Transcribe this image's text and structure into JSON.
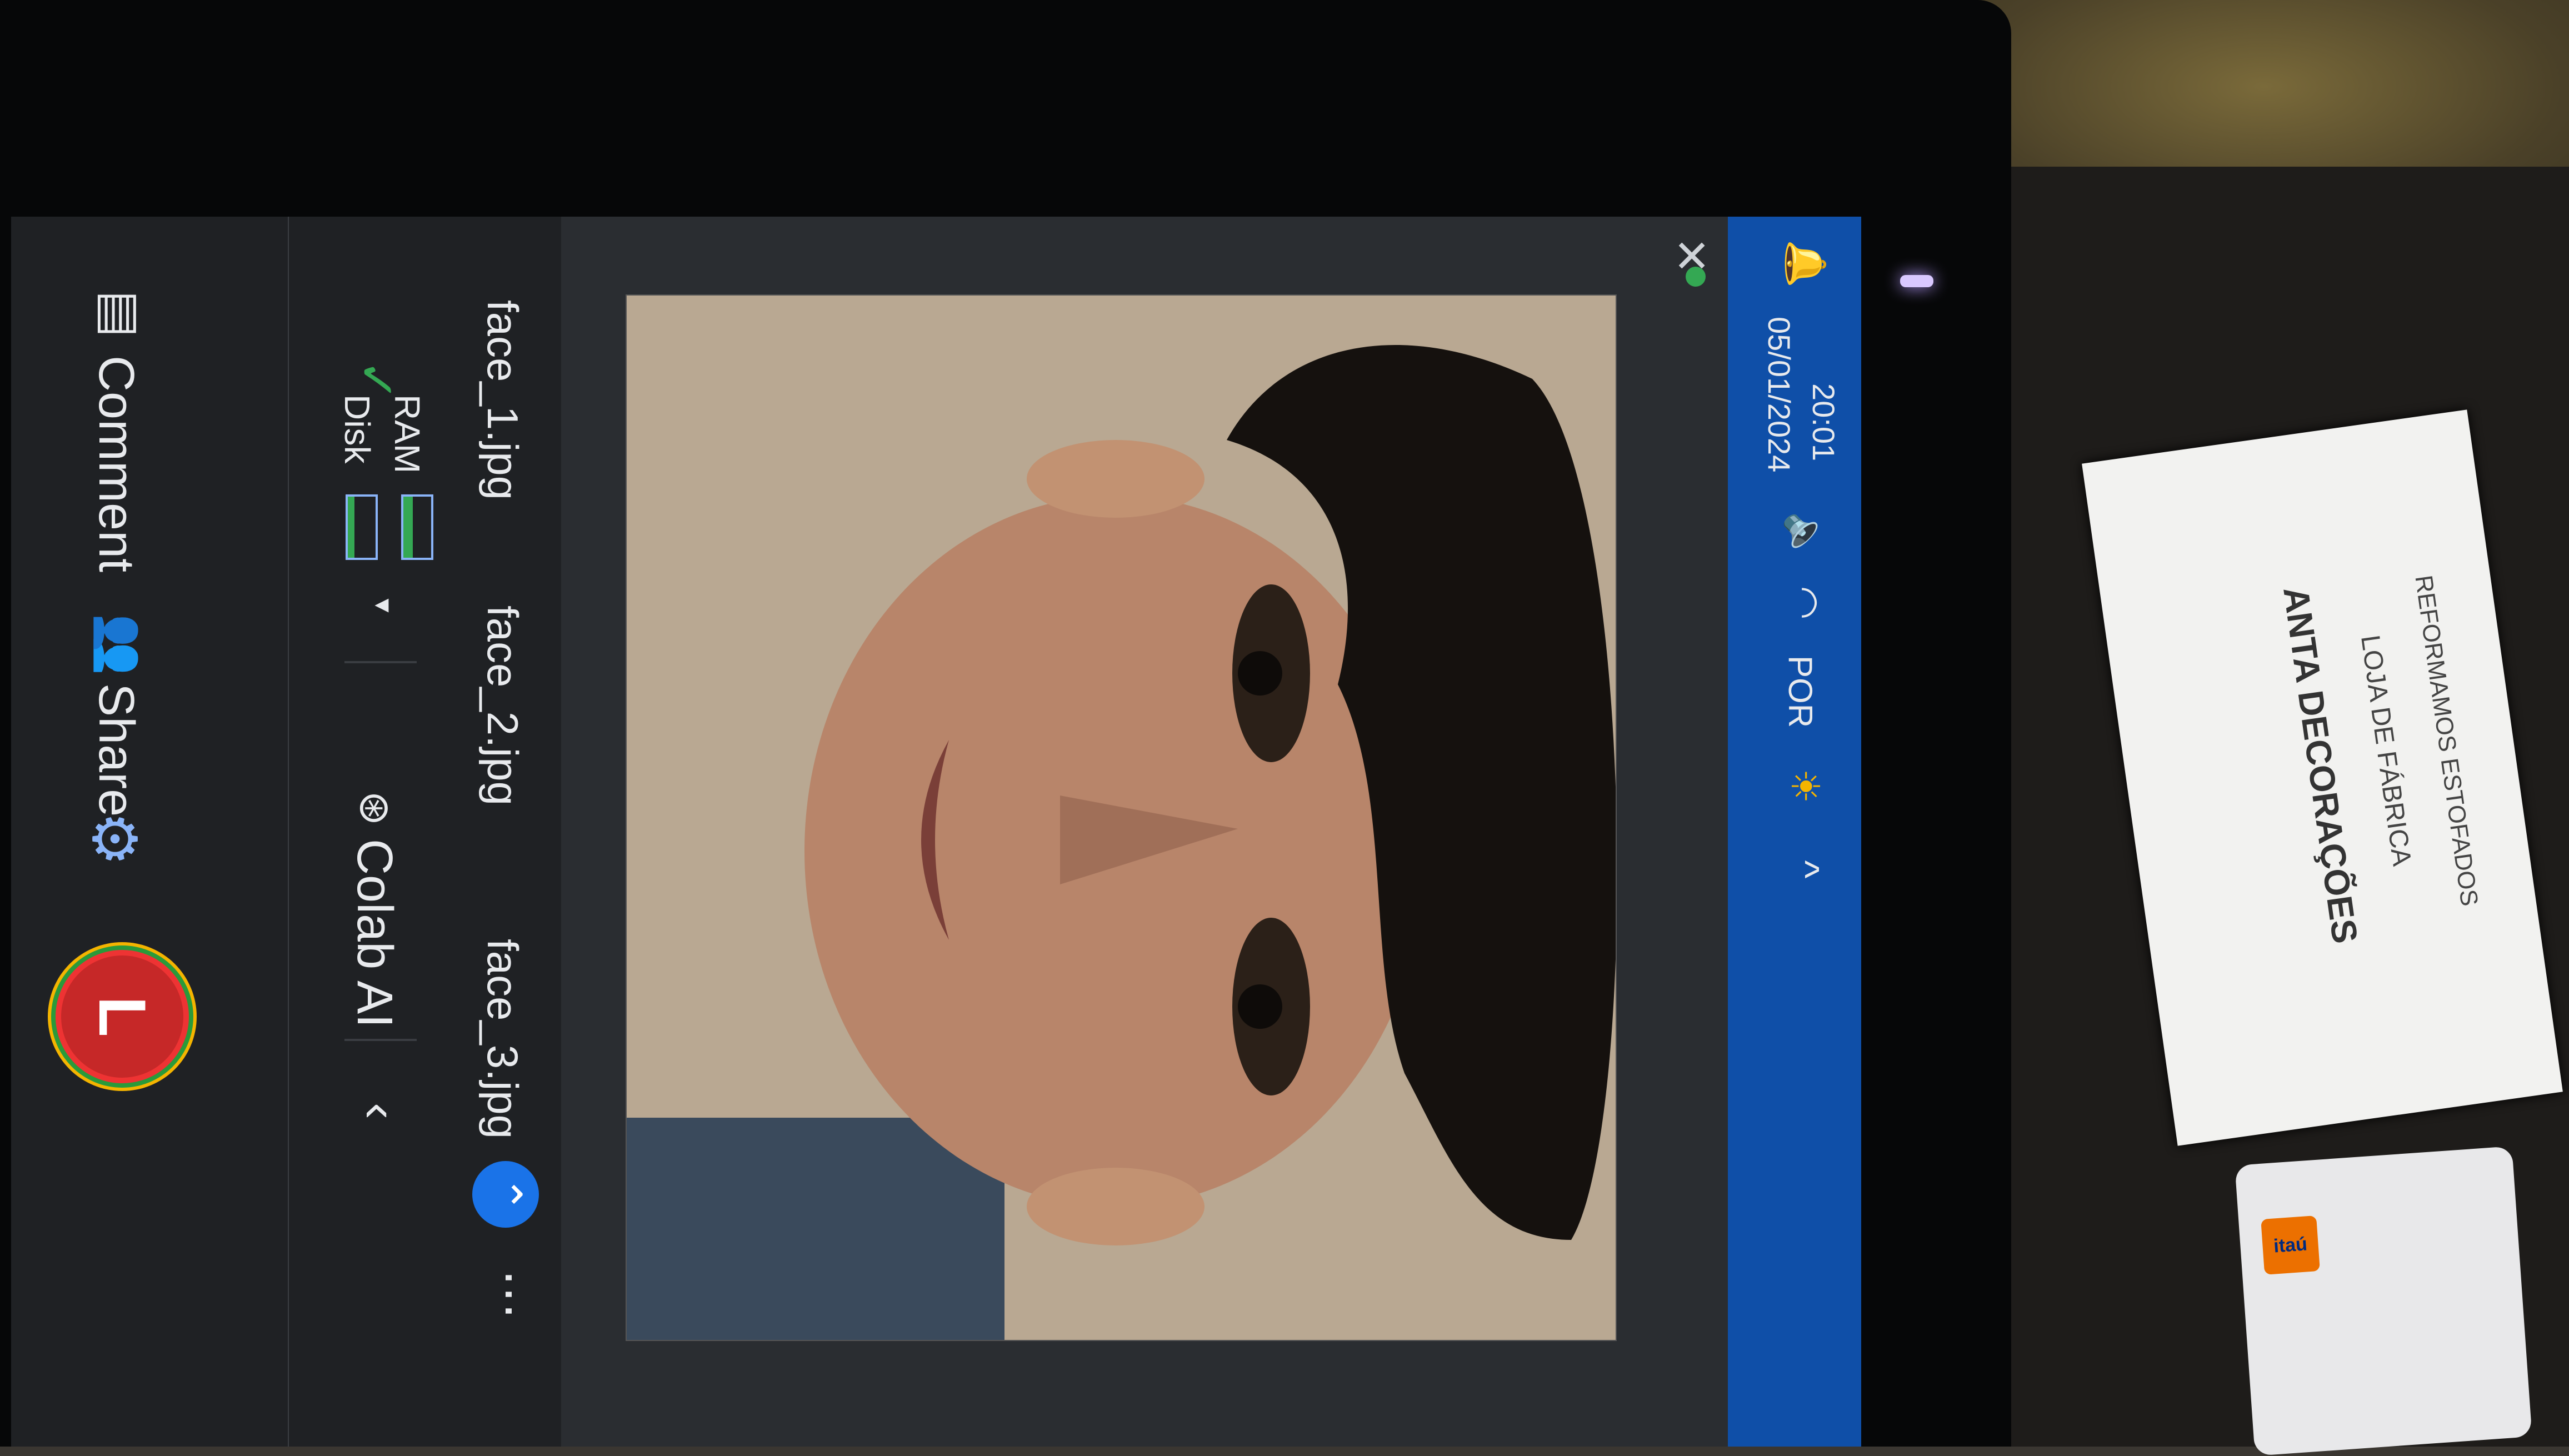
{
  "header": {
    "comment_label": "Comment",
    "share_label": "Share",
    "avatar_letter": "L"
  },
  "toolbar": {
    "ram_label": "RAM",
    "disk_label": "Disk",
    "ram_level": 0.35,
    "disk_level": 0.25,
    "colab_ai_label": "Colab AI"
  },
  "tabs": [
    {
      "label": "face_1.jpg"
    },
    {
      "label": "face_2.jpg"
    },
    {
      "label": "face_3.jpg"
    }
  ],
  "taskbar": {
    "language": "POR",
    "time": "20:01",
    "date": "05/01/2024"
  },
  "card": {
    "title": "ANTA DECORAÇÕES",
    "subtitle": "LOJA DE FÁBRICA",
    "tagline": "REFORMAMOS ESTOFADOS"
  },
  "bank_card": {
    "brand": "itaú"
  },
  "colors": {
    "accent": "#1a73e8",
    "taskbar": "#0f4fa8",
    "status_ok": "#34a853",
    "avatar": "#c62828"
  }
}
